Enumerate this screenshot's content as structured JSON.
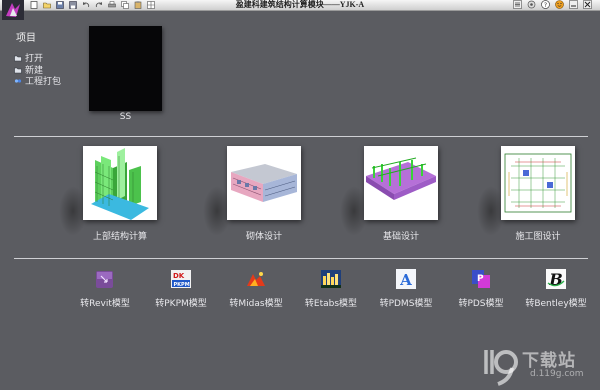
{
  "titlebar": {
    "title": "盈建科建筑结构计算模块——YJK-A",
    "tool_icons": [
      "new-file-icon",
      "open-folder-icon",
      "save-icon",
      "save-as-icon",
      "undo-icon",
      "redo-icon",
      "print-icon",
      "copy-icon",
      "clipboard-icon",
      "grid-icon"
    ],
    "window_icons": [
      "menu-icon",
      "settings-icon",
      "help-icon",
      "skin-icon",
      "minimize-icon",
      "close-icon"
    ]
  },
  "project": {
    "heading": "项目",
    "menu": [
      {
        "label": "打开",
        "icon": "open-icon"
      },
      {
        "label": "新建",
        "icon": "new-icon"
      },
      {
        "label": "工程打包",
        "icon": "package-icon"
      }
    ],
    "thumb_label": "SS"
  },
  "modules": [
    {
      "label": "上部结构计算",
      "icon": "building-structure-icon"
    },
    {
      "label": "砌体设计",
      "icon": "masonry-building-icon"
    },
    {
      "label": "基础设计",
      "icon": "foundation-icon"
    },
    {
      "label": "施工图设计",
      "icon": "construction-drawing-icon"
    }
  ],
  "converters": [
    {
      "label": "转Revit模型",
      "icon": "revit-icon"
    },
    {
      "label": "转PKPM模型",
      "icon": "pkpm-icon"
    },
    {
      "label": "转Midas模型",
      "icon": "midas-icon"
    },
    {
      "label": "转Etabs模型",
      "icon": "etabs-icon"
    },
    {
      "label": "转PDMS模型",
      "icon": "pdms-icon"
    },
    {
      "label": "转PDS模型",
      "icon": "pds-icon"
    },
    {
      "label": "转Bentley模型",
      "icon": "bentley-icon"
    }
  ],
  "watermark": {
    "text": "下载站",
    "url": "d.119g.com"
  }
}
